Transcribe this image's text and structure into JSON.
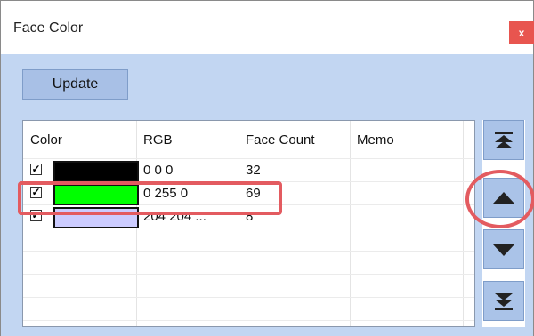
{
  "window": {
    "title": "Face Color",
    "close_label": "x"
  },
  "toolbar": {
    "update_label": "Update"
  },
  "table": {
    "columns": [
      "Color",
      "RGB",
      "Face Count",
      "Memo"
    ],
    "rows": [
      {
        "checked": "☑",
        "swatch": "#000000",
        "rgb": "0 0 0",
        "face_count": "32",
        "memo": ""
      },
      {
        "checked": "☑",
        "swatch": "#00ff00",
        "rgb": "0 255 0",
        "face_count": "69",
        "memo": ""
      },
      {
        "checked": "☑",
        "swatch": "#ccccff",
        "rgb": "204 204 ...",
        "face_count": "8",
        "memo": ""
      }
    ]
  },
  "sidebar": {
    "buttons": [
      {
        "name": "move-top-button",
        "icon": "double-up-arrow-icon"
      },
      {
        "name": "move-up-button",
        "icon": "up-arrow-icon"
      },
      {
        "name": "move-down-button",
        "icon": "down-arrow-icon"
      },
      {
        "name": "move-bottom-button",
        "icon": "double-down-arrow-icon"
      }
    ]
  },
  "annotations": {
    "highlight_color": "#e35b60",
    "highlighted_row": 1,
    "circled_button": "move-up-button"
  },
  "colors": {
    "client_bg": "#c2d6f2",
    "button_bg": "#a8c0e6",
    "close_bg": "#e8554f"
  }
}
